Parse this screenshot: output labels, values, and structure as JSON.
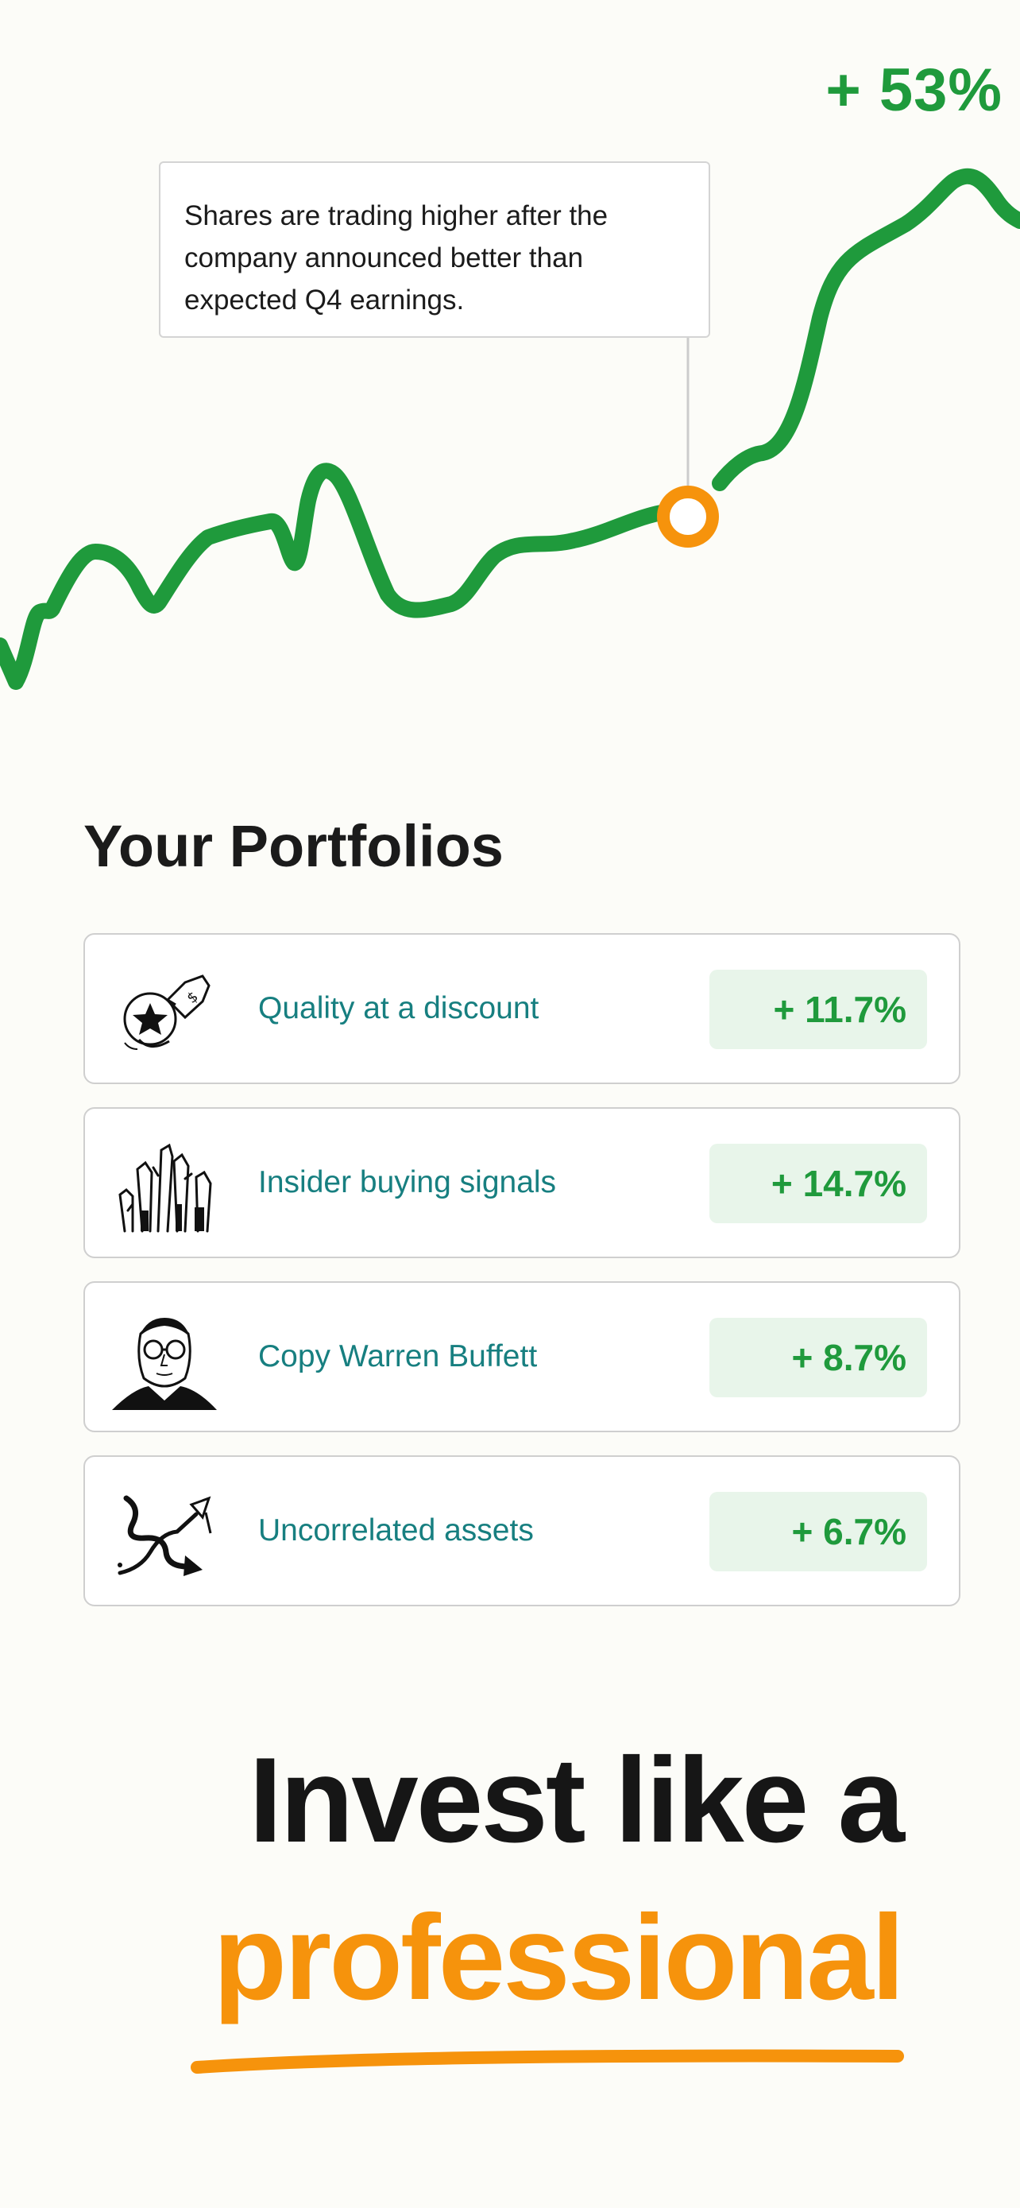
{
  "hero": {
    "change_label": "+ 53%",
    "tooltip_text": "Shares are trading higher after the company announced better than expected Q4 earnings."
  },
  "colors": {
    "accent_green": "#1f9a3c",
    "accent_orange": "#f6930c",
    "teal_text": "#177f80",
    "badge_bg": "#e8f5ea"
  },
  "portfolios": {
    "title": "Your Portfolios",
    "items": [
      {
        "name": "Quality at a discount",
        "return": "+ 11.7%",
        "icon": "price-tag-star-icon"
      },
      {
        "name": "Insider buying signals",
        "return": "+ 14.7%",
        "icon": "thumbs-up-hands-icon"
      },
      {
        "name": "Copy Warren Buffett",
        "return": "+ 8.7%",
        "icon": "warren-buffett-portrait-icon"
      },
      {
        "name": "Uncorrelated assets",
        "return": "+ 6.7%",
        "icon": "diverging-arrows-icon"
      }
    ]
  },
  "headline": {
    "line1": "Invest like a",
    "line2": "professional"
  }
}
